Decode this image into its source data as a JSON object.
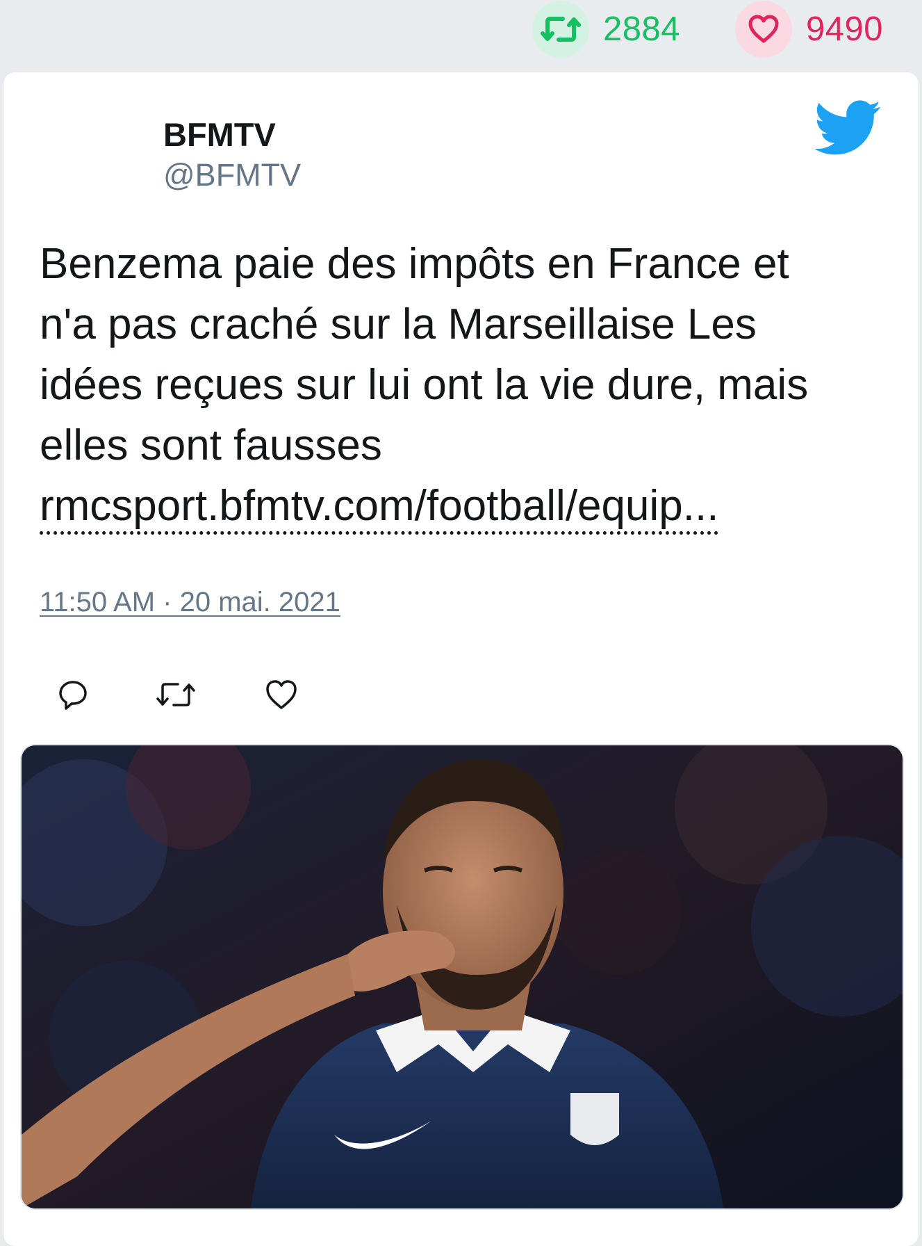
{
  "stats": {
    "retweets": "2884",
    "likes": "9490"
  },
  "tweet": {
    "display_name": "BFMTV",
    "handle": "@BFMTV",
    "text_lines": [
      "Benzema paie des impôts en France et",
      "n'a pas craché sur la Marseillaise Les",
      "idées reçues sur lui ont la vie dure, mais",
      "elles sont fausses"
    ],
    "link_text": "rmcsport.bfmtv.com/football/equip...",
    "timestamp": "11:50 AM · 20 mai. 2021"
  },
  "icons": {
    "stats_retweet": "retweet-icon",
    "stats_like": "heart-icon",
    "brand": "twitter-bird-icon",
    "reply": "reply-icon",
    "retweet": "retweet-icon",
    "like": "heart-icon"
  },
  "colors": {
    "retweet_green": "#17bf63",
    "like_red": "#e0245e",
    "twitter_blue": "#1da1f2",
    "text_primary": "#14171a",
    "text_secondary": "#657786"
  }
}
